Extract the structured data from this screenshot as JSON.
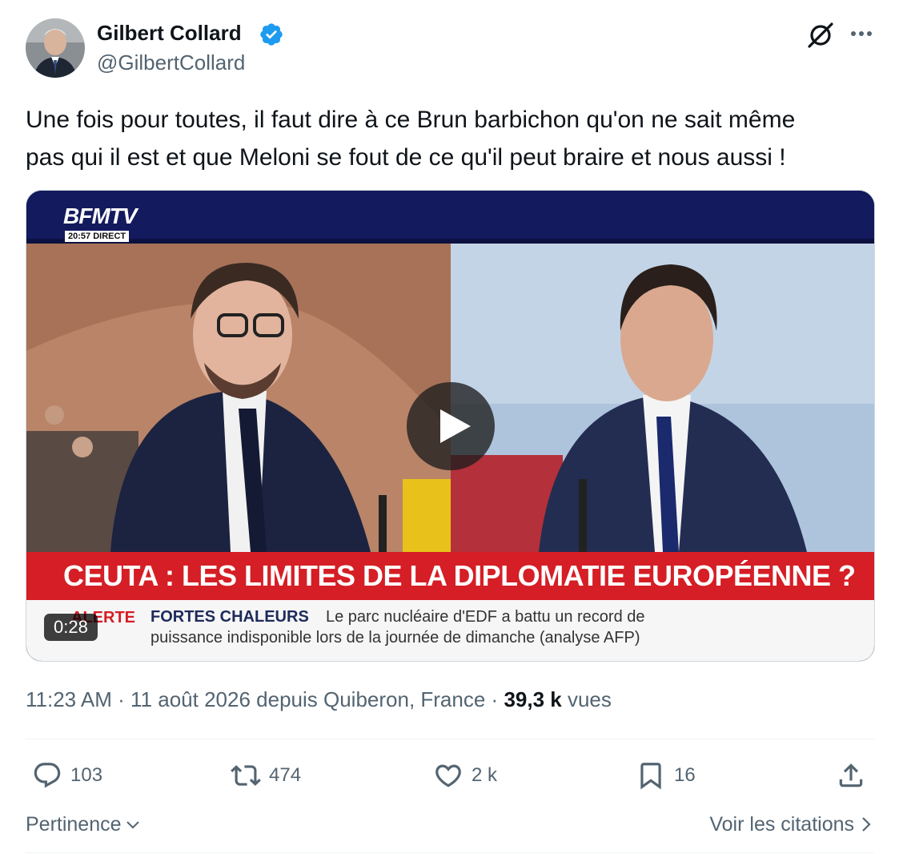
{
  "author": {
    "name": "Gilbert Collard",
    "handle": "@GilbertCollard",
    "verified": true
  },
  "tweet": {
    "text": "Une fois pour toutes, il faut dire à ce Brun barbichon qu'on ne sait même\npas qui il est et que Meloni se fout de ce qu'il peut braire et nous aussi !"
  },
  "media": {
    "duration": "0:28",
    "channel": "BFMTV",
    "time_label": "20:57 DIRECT",
    "headline": "CEUTA : LES LIMITES DE LA DIPLOMATIE EUROPÉENNE ?",
    "alert_label": "ALERTE",
    "ticker_heading": "FORTES CHALEURS",
    "ticker_line1": "Le parc nucléaire d'EDF a battu un record de",
    "ticker_line2": "puissance indisponible lors de la journée de dimanche (analyse AFP)"
  },
  "meta": {
    "time": "11:23 AM",
    "date_location": "11 août 2026 depuis Quiberon, France",
    "views_count": "39,3 k",
    "views_label": "vues"
  },
  "actions": {
    "replies": "103",
    "reposts": "474",
    "likes": "2 k",
    "bookmarks": "16"
  },
  "footer": {
    "sort_label": "Pertinence",
    "quotes_label": "Voir les citations"
  },
  "colors": {
    "verified_blue": "#1d9bf0",
    "secondary_text": "#536471",
    "headline_red": "#d51e25"
  },
  "icons": [
    "verified-badge-icon",
    "grok-icon",
    "more-icon",
    "play-icon",
    "reply-icon",
    "repost-icon",
    "like-icon",
    "bookmark-icon",
    "share-icon",
    "chevron-down-icon",
    "chevron-right-icon"
  ]
}
